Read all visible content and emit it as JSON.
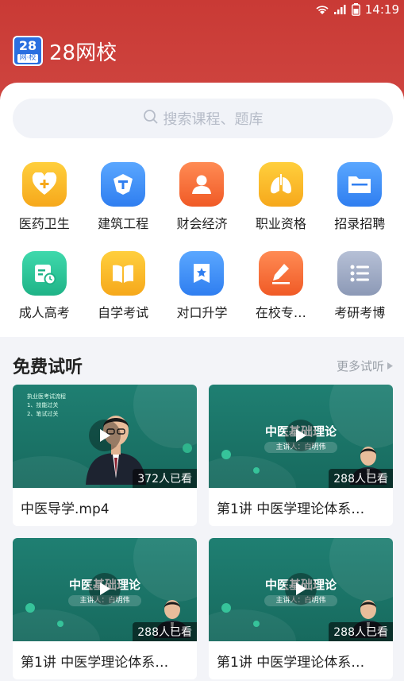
{
  "status": {
    "time": "14:19"
  },
  "brand": {
    "logo_number": "28",
    "logo_sub": "网·校",
    "name": "28网校"
  },
  "search": {
    "placeholder": "搜索课程、题库"
  },
  "categories": [
    {
      "label": "医药卫生",
      "icon": "heart-plus-icon",
      "color": "#f7b928"
    },
    {
      "label": "建筑工程",
      "icon": "shield-t-icon",
      "color": "#3f8ef5"
    },
    {
      "label": "财会经济",
      "icon": "person-icon",
      "color": "#f5713a"
    },
    {
      "label": "职业资格",
      "icon": "lungs-icon",
      "color": "#f7b928"
    },
    {
      "label": "招录招聘",
      "icon": "folder-icon",
      "color": "#3f8ef5"
    },
    {
      "label": "成人高考",
      "icon": "calendar-icon",
      "color": "#2cc59b"
    },
    {
      "label": "自学考试",
      "icon": "book-icon",
      "color": "#f7b928"
    },
    {
      "label": "对口升学",
      "icon": "star-bookmark-icon",
      "color": "#3f8ef5"
    },
    {
      "label": "在校专…",
      "icon": "pencil-icon",
      "color": "#f5713a"
    },
    {
      "label": "考研考博",
      "icon": "list-icon",
      "color": "#9aa6c0"
    }
  ],
  "free_trial": {
    "title": "免费试听",
    "more": "更多试听"
  },
  "videos": [
    {
      "title": "中医导学.mp4",
      "views": "372人已看",
      "slide_lines": [
        "执业医考试流程",
        "1、技能过关",
        "2、笔试过关"
      ]
    },
    {
      "title": "第1讲 中医学理论体系…",
      "views": "288人已看",
      "slide_title": "中医基础理论",
      "slide_sub": "主讲人：白明伟"
    },
    {
      "title": "第1讲 中医学理论体系…",
      "views": "288人已看",
      "slide_title": "中医基础理论",
      "slide_sub": "主讲人：白明伟"
    },
    {
      "title": "第1讲 中医学理论体系…",
      "views": "288人已看",
      "slide_title": "中医基础理论",
      "slide_sub": "主讲人：白明伟"
    }
  ]
}
